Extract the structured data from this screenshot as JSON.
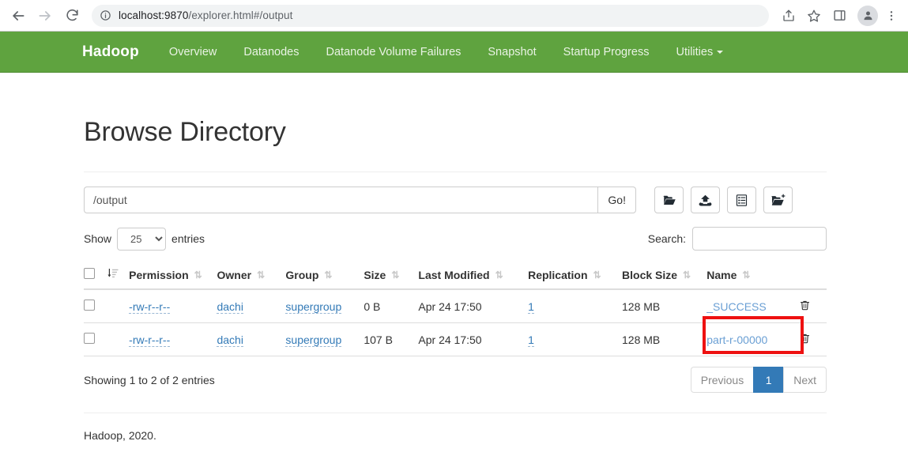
{
  "browser": {
    "url_host": "localhost:9870",
    "url_path": "/explorer.html#/output",
    "back_icon": "back-arrow-icon",
    "forward_icon": "forward-arrow-icon",
    "reload_icon": "reload-icon",
    "site_info_icon": "info-circle-icon",
    "share_icon": "share-icon",
    "bookmark_icon": "star-icon",
    "sidepanel_icon": "side-panel-icon",
    "avatar_icon": "profile-avatar-icon",
    "menu_icon": "three-dot-menu-icon"
  },
  "navbar": {
    "brand": "Hadoop",
    "brand_color": "#ffffff",
    "background_color": "#5fa33f",
    "links": [
      {
        "label": "Overview"
      },
      {
        "label": "Datanodes"
      },
      {
        "label": "Datanode Volume Failures"
      },
      {
        "label": "Snapshot"
      },
      {
        "label": "Startup Progress"
      },
      {
        "label": "Utilities",
        "has_caret": true
      }
    ]
  },
  "page": {
    "title": "Browse Directory"
  },
  "path_bar": {
    "value": "/output",
    "placeholder": "",
    "go_label": "Go!",
    "tools": [
      {
        "name": "cut-folder-icon",
        "title": "Cut"
      },
      {
        "name": "upload-icon",
        "title": "Upload"
      },
      {
        "name": "list-snapshot-icon",
        "title": "Snapshots"
      },
      {
        "name": "new-folder-icon",
        "title": "Create Directory"
      }
    ]
  },
  "controls": {
    "show_label": "Show",
    "entries_value": "25",
    "entries_options": [
      "25",
      "50",
      "100"
    ],
    "entries_label": "entries",
    "search_label": "Search:",
    "search_value": "",
    "search_placeholder": ""
  },
  "table": {
    "columns": [
      {
        "key": "check",
        "label": ""
      },
      {
        "key": "sortmark",
        "label": ""
      },
      {
        "key": "permission",
        "label": "Permission"
      },
      {
        "key": "owner",
        "label": "Owner"
      },
      {
        "key": "group",
        "label": "Group"
      },
      {
        "key": "size",
        "label": "Size"
      },
      {
        "key": "modified",
        "label": "Last Modified"
      },
      {
        "key": "replication",
        "label": "Replication"
      },
      {
        "key": "blocksize",
        "label": "Block Size"
      },
      {
        "key": "name",
        "label": "Name"
      },
      {
        "key": "trash",
        "label": ""
      }
    ],
    "rows": [
      {
        "permission": "-rw-r--r--",
        "owner": "dachi",
        "group": "supergroup",
        "size": "0 B",
        "modified": "Apr 24 17:50",
        "replication": "1",
        "blocksize": "128 MB",
        "name": "_SUCCESS"
      },
      {
        "permission": "-rw-r--r--",
        "owner": "dachi",
        "group": "supergroup",
        "size": "107 B",
        "modified": "Apr 24 17:50",
        "replication": "1",
        "blocksize": "128 MB",
        "name": "part-r-00000"
      }
    ]
  },
  "table_footer": {
    "showing": "Showing 1 to 2 of 2 entries",
    "pagination": {
      "previous": "Previous",
      "pages": [
        "1"
      ],
      "next": "Next",
      "active_page": "1",
      "active_color": "#337ab7"
    }
  },
  "footer": {
    "text": "Hadoop, 2020."
  },
  "annotation": {
    "target": "part-r-00000",
    "color": "#ee1111"
  }
}
